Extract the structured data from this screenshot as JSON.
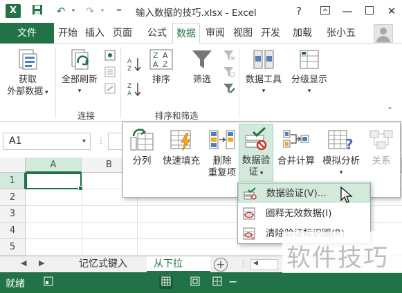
{
  "window": {
    "logo": "X",
    "title": "输入数据的技巧.xlsx - Excel",
    "help": "?"
  },
  "tabs": {
    "file": "文件",
    "items": [
      "开始",
      "插入",
      "页面",
      "公式",
      "数据",
      "审阅",
      "视图",
      "开发",
      "加载"
    ],
    "active": "数据",
    "user": "张小五"
  },
  "ribbon": {
    "get_data": {
      "line1": "获取",
      "line2": "外部数据"
    },
    "refresh_all": "全部刷新",
    "group_connections": "连接",
    "sort": "排序",
    "filter": "筛选",
    "group_sort_filter": "排序和筛选",
    "data_tools": "数据工具",
    "outline": "分级显示"
  },
  "namebox": {
    "value": "A1"
  },
  "grid": {
    "columns": [
      "A",
      "B"
    ],
    "rows": [
      "1",
      "2",
      "3",
      "4",
      "5"
    ],
    "active_cell": "A1"
  },
  "data_tools_dropdown": {
    "text_to_columns": "分列",
    "flash_fill": "快速填充",
    "remove_duplicates": {
      "line1": "删除",
      "line2": "重复项"
    },
    "data_validation": {
      "line1": "数据验",
      "line2": "证"
    },
    "consolidate": "合并计算",
    "what_if": "模拟分析",
    "relationships": "关系"
  },
  "validation_menu": {
    "items": [
      "数据验证(V)...",
      "圈释无效数据(I)",
      "清除验证标识圈(R)"
    ]
  },
  "sheets": {
    "tabs": [
      "记忆式键入",
      "从下拉"
    ],
    "active": "从下拉"
  },
  "status": {
    "text": "就绪"
  },
  "watermark": "软件技巧",
  "colors": {
    "excel_green": "#217346",
    "selection_fill": "#d3e9dc"
  }
}
